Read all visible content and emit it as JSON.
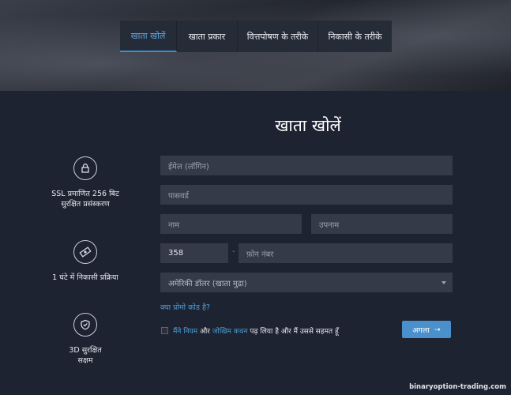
{
  "tabs": [
    {
      "label": "खाता खोलें",
      "active": true
    },
    {
      "label": "खाता प्रकार",
      "active": false
    },
    {
      "label": "वित्तपोषण के तरीके",
      "active": false
    },
    {
      "label": "निकासी के तरीके",
      "active": false
    }
  ],
  "form": {
    "title": "खाता खोलें",
    "email_placeholder": "ईमेल (लॉगिन)",
    "password_placeholder": "पासवर्ड",
    "first_name_placeholder": "नाम",
    "last_name_placeholder": "उपनाम",
    "country_code_value": "358",
    "phone_separator": "-",
    "phone_placeholder": "फ़ोन नंबर",
    "currency_selected": "अमेरिकी डॉलर (खाता मुद्रा)",
    "promo_link": "क्या प्रोमो कोड है?",
    "consent": {
      "prefix": "मैंने",
      "rules_link": "नियम",
      "and": "और",
      "risk_link": "जोखिम कथन",
      "suffix": "पढ़ लिया है और मैं उससे सहमत हूँ"
    },
    "next_button": "अगला",
    "next_arrow": "→"
  },
  "features": [
    {
      "icon": "lock-icon",
      "text": "SSL प्रमाणित 256 बिट\nसुरक्षित प्रसंस्करण"
    },
    {
      "icon": "money-icon",
      "text": "1 घंटे में निकासी प्रक्रिया"
    },
    {
      "icon": "shield-icon",
      "text": "3D सुरक्षित\nसक्षम"
    }
  ],
  "watermark": "binaryoption-trading.com",
  "colors": {
    "accent": "#4990cc",
    "background": "#1e2331",
    "field": "#353a48",
    "link": "#4b9fd6"
  }
}
